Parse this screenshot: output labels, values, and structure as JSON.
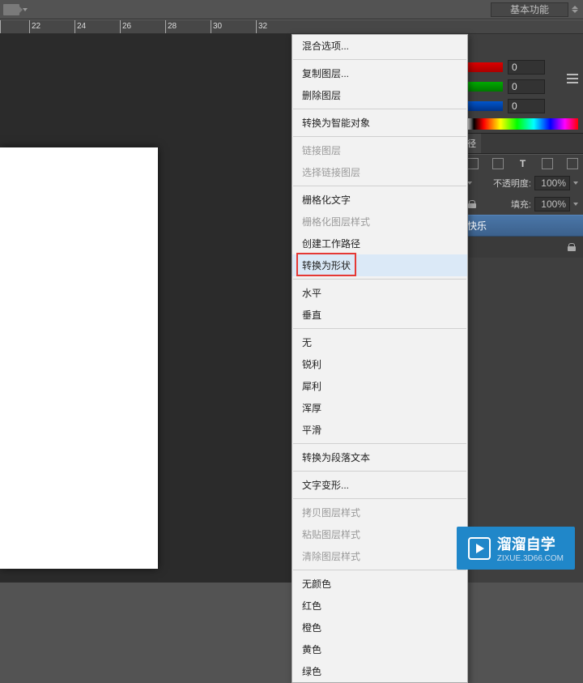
{
  "topbar": {
    "workspace_label": "基本功能"
  },
  "ruler": {
    "ticks": [
      {
        "pos": 0,
        "label": ""
      },
      {
        "pos": 36,
        "label": "22"
      },
      {
        "pos": 92,
        "label": "24"
      },
      {
        "pos": 148,
        "label": "26"
      },
      {
        "pos": 204,
        "label": "28"
      },
      {
        "pos": 260,
        "label": "30"
      },
      {
        "pos": 316,
        "label": "32"
      }
    ]
  },
  "color_panel": {
    "r": "0",
    "g": "0",
    "b": "0"
  },
  "layers_panel": {
    "tabs": [
      "径"
    ],
    "opacity_label": "不透明度:",
    "opacity_value": "100%",
    "fill_label": "填充:",
    "fill_value": "100%",
    "layer_name": "快乐"
  },
  "ctx_menu": {
    "items": [
      {
        "label": "混合选项...",
        "enabled": true
      },
      {
        "sep": true
      },
      {
        "label": "复制图层...",
        "enabled": true
      },
      {
        "label": "删除图层",
        "enabled": true
      },
      {
        "sep": true
      },
      {
        "label": "转换为智能对象",
        "enabled": true
      },
      {
        "sep": true
      },
      {
        "label": "链接图层",
        "enabled": false
      },
      {
        "label": "选择链接图层",
        "enabled": false
      },
      {
        "sep": true
      },
      {
        "label": "栅格化文字",
        "enabled": true
      },
      {
        "label": "栅格化图层样式",
        "enabled": false
      },
      {
        "label": "创建工作路径",
        "enabled": true
      },
      {
        "label": "转换为形状",
        "enabled": true,
        "highlight": true
      },
      {
        "sep": true
      },
      {
        "label": "水平",
        "enabled": true
      },
      {
        "label": "垂直",
        "enabled": true
      },
      {
        "sep": true
      },
      {
        "label": "无",
        "enabled": true
      },
      {
        "label": "锐利",
        "enabled": true
      },
      {
        "label": "犀利",
        "enabled": true
      },
      {
        "label": "浑厚",
        "enabled": true
      },
      {
        "label": "平滑",
        "enabled": true
      },
      {
        "sep": true
      },
      {
        "label": "转换为段落文本",
        "enabled": true
      },
      {
        "sep": true
      },
      {
        "label": "文字变形...",
        "enabled": true
      },
      {
        "sep": true
      },
      {
        "label": "拷贝图层样式",
        "enabled": false
      },
      {
        "label": "粘贴图层样式",
        "enabled": false
      },
      {
        "label": "清除图层样式",
        "enabled": false
      },
      {
        "sep": true
      },
      {
        "label": "无颜色",
        "enabled": true
      },
      {
        "label": "红色",
        "enabled": true
      },
      {
        "label": "橙色",
        "enabled": true
      },
      {
        "label": "黄色",
        "enabled": true
      },
      {
        "label": "绿色",
        "enabled": true
      }
    ]
  },
  "watermark": {
    "title": "溜溜自学",
    "sub": "ZIXUE.3D66.COM"
  }
}
